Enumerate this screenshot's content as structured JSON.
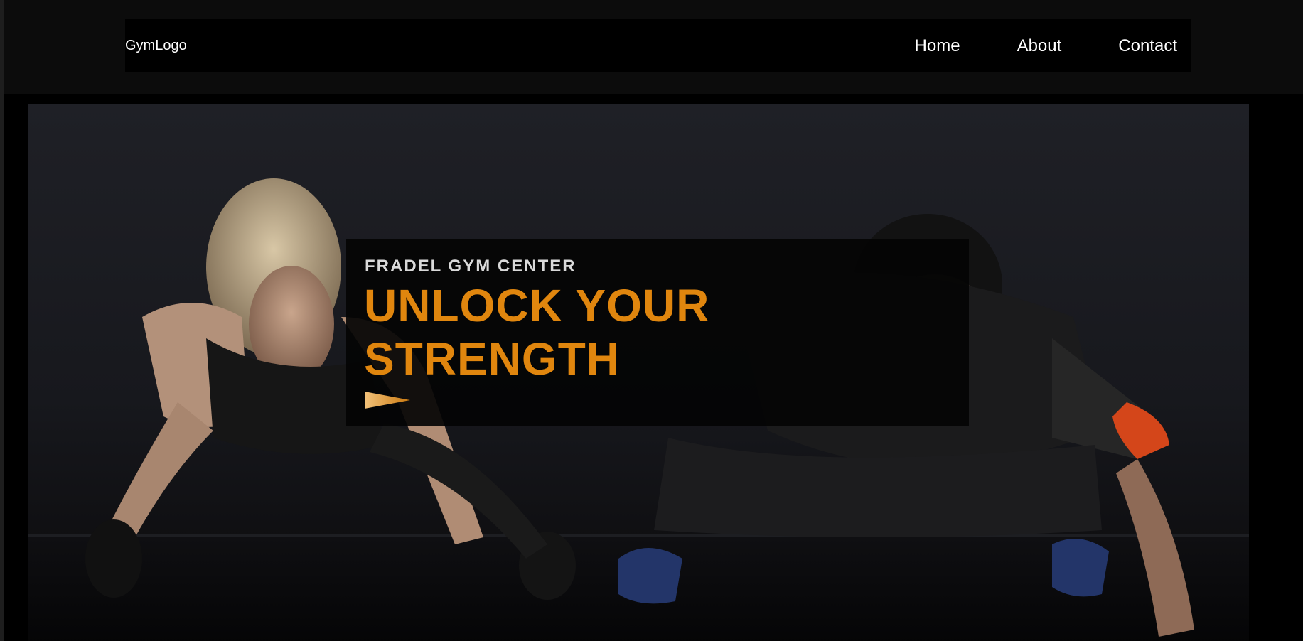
{
  "header": {
    "logo_text": "GymLogo",
    "nav_items": [
      {
        "label": "Home"
      },
      {
        "label": "About"
      },
      {
        "label": "Contact"
      }
    ]
  },
  "hero": {
    "subtitle": "FRADEL GYM CENTER",
    "headline_line1": "UNLOCK YOUR",
    "headline_line2": "STRENGTH",
    "cta_icon": "play-arrow-icon",
    "background_image": "two people doing one-arm push-ups in a dark gym"
  },
  "colors": {
    "accent": "#e0860e",
    "background": "#0b0b0c",
    "navbar": "#000000",
    "text": "#ffffff"
  }
}
